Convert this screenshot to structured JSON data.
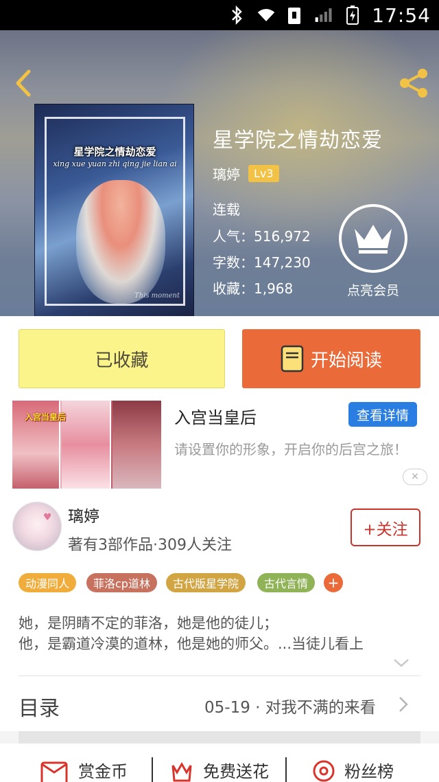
{
  "status_bar": {
    "time": "17:54",
    "icons": [
      "bluetooth-icon",
      "wifi-icon",
      "sim-notification-icon",
      "signal-icon",
      "battery-charging-icon"
    ]
  },
  "header": {
    "back_icon": "chevron-left-icon",
    "share_icon": "share-icon",
    "cover": {
      "title_text": "星学院之情劫恋爱",
      "subtitle_text": "xing xue yuan zhi qing jie lian ai",
      "signature": "This moment"
    },
    "book_title": "星学院之情劫恋爱",
    "author": "璃婷",
    "level": "Lv3",
    "status": "连载",
    "popularity": "人气：516,972",
    "word_count": "字数：147,230",
    "favorites": "收藏：1,968",
    "vip_icon": "crown-icon",
    "vip_label": "点亮会员",
    "accent_color": "#f2c247"
  },
  "actions": {
    "favorite_label": "已收藏",
    "read_label": "开始阅读",
    "read_icon": "book-icon",
    "favorite_color": "#fbf48a",
    "read_color": "#ea6a3a"
  },
  "ad": {
    "image_text": "入宫当皇后",
    "title": "入宫当皇后",
    "detail_label": "查看详情",
    "description": "请设置你的形象，开启你的后宫之旅！",
    "close_icon": "close-icon"
  },
  "author_section": {
    "name": "璃婷",
    "stats": "著有3部作品·309人关注",
    "follow_label": "+关注"
  },
  "tags": [
    "动漫同人",
    "菲洛cp道林",
    "古代版星学院",
    "古代言情"
  ],
  "tag_more": "+",
  "description": "她，是阴睛不定的菲洛，她是他的徒儿；\n他，是霸道冷漠的道林，他是她的师父。...当徒儿看上",
  "catalog": {
    "label": "目录",
    "latest": "05-19 · 对我不满的来看"
  },
  "bottom_actions": [
    {
      "label": "赏金币",
      "icon": "reward-envelope-icon"
    },
    {
      "label": "免费送花",
      "icon": "flower-icon"
    },
    {
      "label": "粉丝榜",
      "icon": "fan-rank-icon"
    }
  ]
}
